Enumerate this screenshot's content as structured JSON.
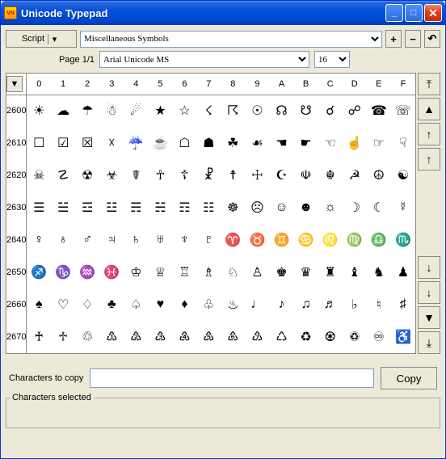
{
  "window": {
    "title": "Unicode Typepad",
    "app_icon_label": "VN"
  },
  "toolbar": {
    "script_label": "Script",
    "category": "Miscellaneous Symbols",
    "plus": "+",
    "minus": "−",
    "reset": "↶"
  },
  "row2": {
    "page_label": "Page 1/1",
    "font": "Arial Unicode MS",
    "fontsize": "16"
  },
  "grid": {
    "cols": [
      "0",
      "1",
      "2",
      "3",
      "4",
      "5",
      "6",
      "7",
      "8",
      "9",
      "A",
      "B",
      "C",
      "D",
      "E",
      "F"
    ],
    "rows": [
      {
        "hex": "2600",
        "chars": [
          "☀",
          "☁",
          "☂",
          "☃",
          "☄",
          "★",
          "☆",
          "☇",
          "☈",
          "☉",
          "☊",
          "☋",
          "☌",
          "☍",
          "☎",
          "☏"
        ]
      },
      {
        "hex": "2610",
        "chars": [
          "☐",
          "☑",
          "☒",
          "☓",
          "☔",
          "☕",
          "☖",
          "☗",
          "☘",
          "☙",
          "☚",
          "☛",
          "☜",
          "☝",
          "☞",
          "☟"
        ]
      },
      {
        "hex": "2620",
        "chars": [
          "☠",
          "☡",
          "☢",
          "☣",
          "☤",
          "☥",
          "☦",
          "☧",
          "☨",
          "☩",
          "☪",
          "☫",
          "☬",
          "☭",
          "☮",
          "☯"
        ]
      },
      {
        "hex": "2630",
        "chars": [
          "☰",
          "☱",
          "☲",
          "☳",
          "☴",
          "☵",
          "☶",
          "☷",
          "☸",
          "☹",
          "☺",
          "☻",
          "☼",
          "☽",
          "☾",
          "☿"
        ]
      },
      {
        "hex": "2640",
        "chars": [
          "♀",
          "♁",
          "♂",
          "♃",
          "♄",
          "♅",
          "♆",
          "♇",
          "♈",
          "♉",
          "♊",
          "♋",
          "♌",
          "♍",
          "♎",
          "♏"
        ]
      },
      {
        "hex": "2650",
        "chars": [
          "♐",
          "♑",
          "♒",
          "♓",
          "♔",
          "♕",
          "♖",
          "♗",
          "♘",
          "♙",
          "♚",
          "♛",
          "♜",
          "♝",
          "♞",
          "♟"
        ]
      },
      {
        "hex": "2660",
        "chars": [
          "♠",
          "♡",
          "♢",
          "♣",
          "♤",
          "♥",
          "♦",
          "♧",
          "♨",
          "♩",
          "♪",
          "♫",
          "♬",
          "♭",
          "♮",
          "♯"
        ]
      },
      {
        "hex": "2670",
        "chars": [
          "♰",
          "♱",
          "♲",
          "♳",
          "♴",
          "♵",
          "♶",
          "♷",
          "♸",
          "♹",
          "♺",
          "♻",
          "♼",
          "♽",
          "♾",
          "♿"
        ]
      }
    ]
  },
  "nav": {
    "top": "⤒",
    "pageup": "▲",
    "up": "↑",
    "up2": "↑",
    "down2": "↓",
    "down": "↓",
    "pagedown": "▼",
    "bottom": "⤓"
  },
  "copy": {
    "label": "Characters to copy",
    "button": "Copy"
  },
  "status": {
    "label": "Characters selected"
  },
  "chart_data": null
}
